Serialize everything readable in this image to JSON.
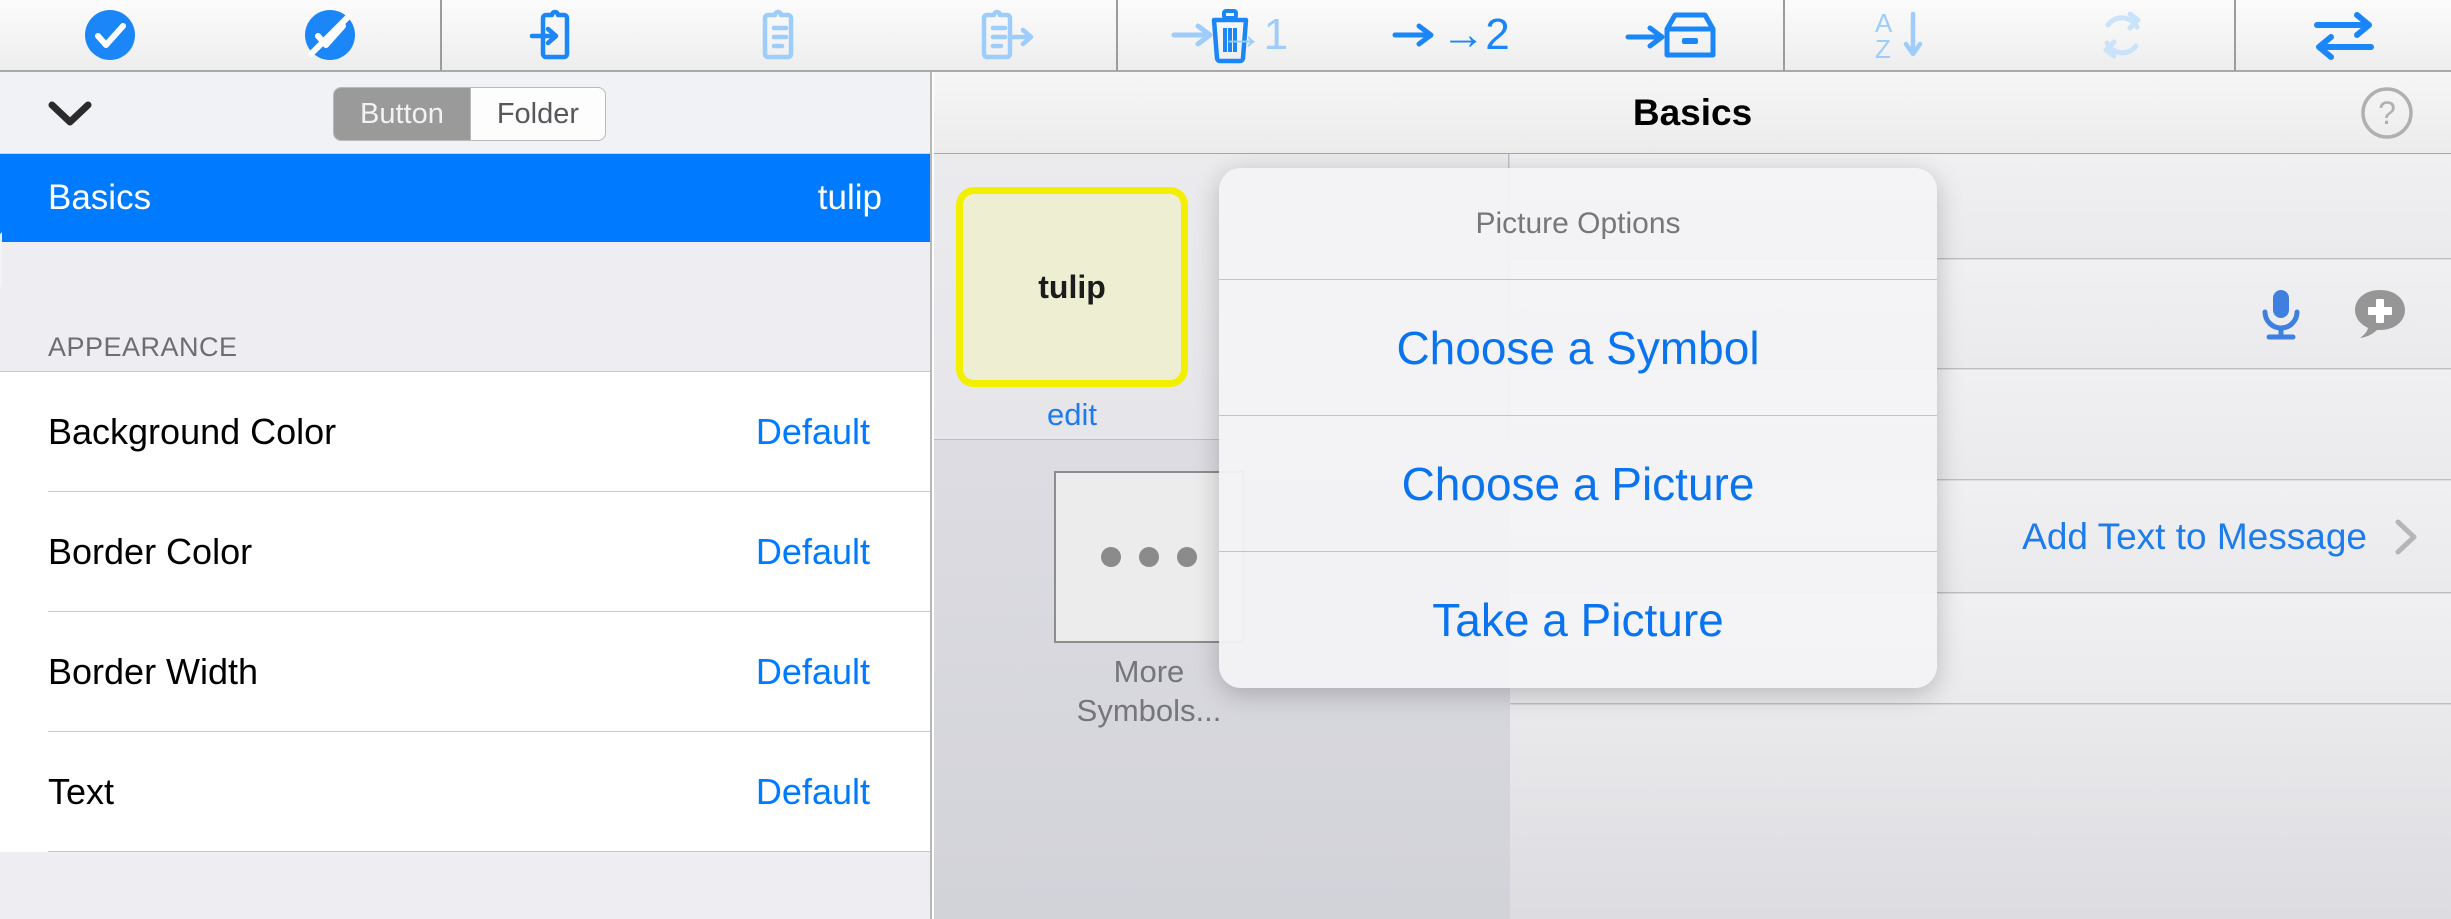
{
  "toolbar": {
    "items": [
      {
        "name": "check-circle-icon",
        "label": "",
        "state": "enabled"
      },
      {
        "name": "check-circle-slash-icon",
        "label": "",
        "state": "enabled"
      },
      {
        "name": "import-to-clipboard-icon",
        "label": "",
        "state": "enabled"
      },
      {
        "name": "clipboard-lines-icon",
        "label": "",
        "state": "disabled"
      },
      {
        "name": "trash-icon",
        "label": "",
        "state": "enabled"
      },
      {
        "name": "move-to-page-1-icon",
        "label": "→1",
        "state": "disabled"
      },
      {
        "name": "move-to-page-2-icon",
        "label": "→2",
        "state": "enabled"
      },
      {
        "name": "move-to-archive-icon",
        "label": "",
        "state": "enabled"
      },
      {
        "name": "sort-az-icon",
        "label": "",
        "state": "disabled"
      },
      {
        "name": "refresh-icon",
        "label": "",
        "state": "disabled"
      },
      {
        "name": "swap-arrows-icon",
        "label": "",
        "state": "enabled"
      }
    ]
  },
  "left_panel": {
    "collapse_chevron": "chevron-down-icon",
    "segmented": {
      "options": [
        "Button",
        "Folder"
      ],
      "selected": "Button"
    },
    "selected_row": {
      "title": "Basics",
      "value": "tulip"
    },
    "section_header": "APPEARANCE",
    "rows": [
      {
        "label": "Background Color",
        "value": "Default"
      },
      {
        "label": "Border Color",
        "value": "Default"
      },
      {
        "label": "Border Width",
        "value": "Default"
      },
      {
        "label": "Text",
        "value": "Default"
      }
    ]
  },
  "right_panel": {
    "title": "Basics",
    "help_icon": "question-mark-circle-icon",
    "button_preview": {
      "label": "tulip",
      "edit_link": "edit",
      "background_color": "#eeeed2",
      "border_color": "#f2ef00"
    },
    "more_symbols": {
      "caption_line1": "More",
      "caption_line2": "Symbols...",
      "icon": "ellipsis-icon"
    },
    "mic_icon": "microphone-icon",
    "add_message_icon": "speech-bubble-plus-icon",
    "add_text_row": {
      "label": "Add Text to Message",
      "chevron": "chevron-right-icon"
    }
  },
  "popover": {
    "title": "Picture Options",
    "items": [
      "Choose a Symbol",
      "Choose a Picture",
      "Take a Picture"
    ]
  },
  "colors": {
    "accent_blue": "#007aff",
    "link_blue": "#1c7ced",
    "selected_row_blue": "#007aff",
    "tile_border_yellow": "#f2ef00",
    "tile_fill_cream": "#eeeed2",
    "disabled_icon_blue": "#9ecdfb"
  }
}
